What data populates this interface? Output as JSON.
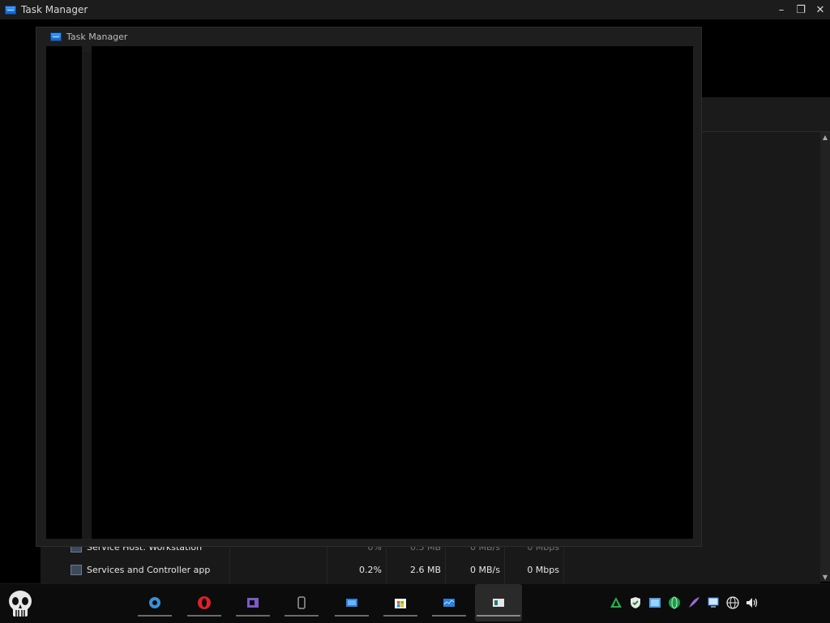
{
  "window": {
    "title": "Task Manager",
    "controls": {
      "minimize": "–",
      "restore": "❐",
      "close": "✕"
    }
  },
  "ghost_window": {
    "title": "Task Manager"
  },
  "process_rows": [
    {
      "name": "Service Host: Workstation",
      "cpu": "0%",
      "memory": "0.5 MB",
      "disk": "0 MB/s",
      "network": "0 Mbps",
      "partially_hidden": true
    },
    {
      "name": "Services and Controller app",
      "cpu": "0.2%",
      "memory": "2.6 MB",
      "disk": "0 MB/s",
      "network": "0 Mbps",
      "partially_hidden": false
    }
  ],
  "taskbar": {
    "start_icon": "skull-icon",
    "pinned": [
      {
        "name": "settings-icon",
        "color": "#3b8fd6"
      },
      {
        "name": "opera-icon",
        "color": "#e0202a"
      },
      {
        "name": "visual-studio-icon",
        "color": "#7a5bc8"
      },
      {
        "name": "phone-link-icon",
        "color": "#9a9a9a"
      },
      {
        "name": "remote-desktop-icon",
        "color": "#2a7fe0"
      },
      {
        "name": "microsoft-store-icon",
        "color": "#f2b01e"
      },
      {
        "name": "task-manager-icon",
        "color": "#2a7fe0"
      },
      {
        "name": "active-window-icon",
        "color": "#e6e6e6"
      }
    ],
    "tray": [
      "up-arrow-green-icon",
      "shield-check-icon",
      "network-drive-icon",
      "globe-sync-icon",
      "feather-icon",
      "monitor-icon",
      "network-globe-icon",
      "volume-icon"
    ]
  }
}
